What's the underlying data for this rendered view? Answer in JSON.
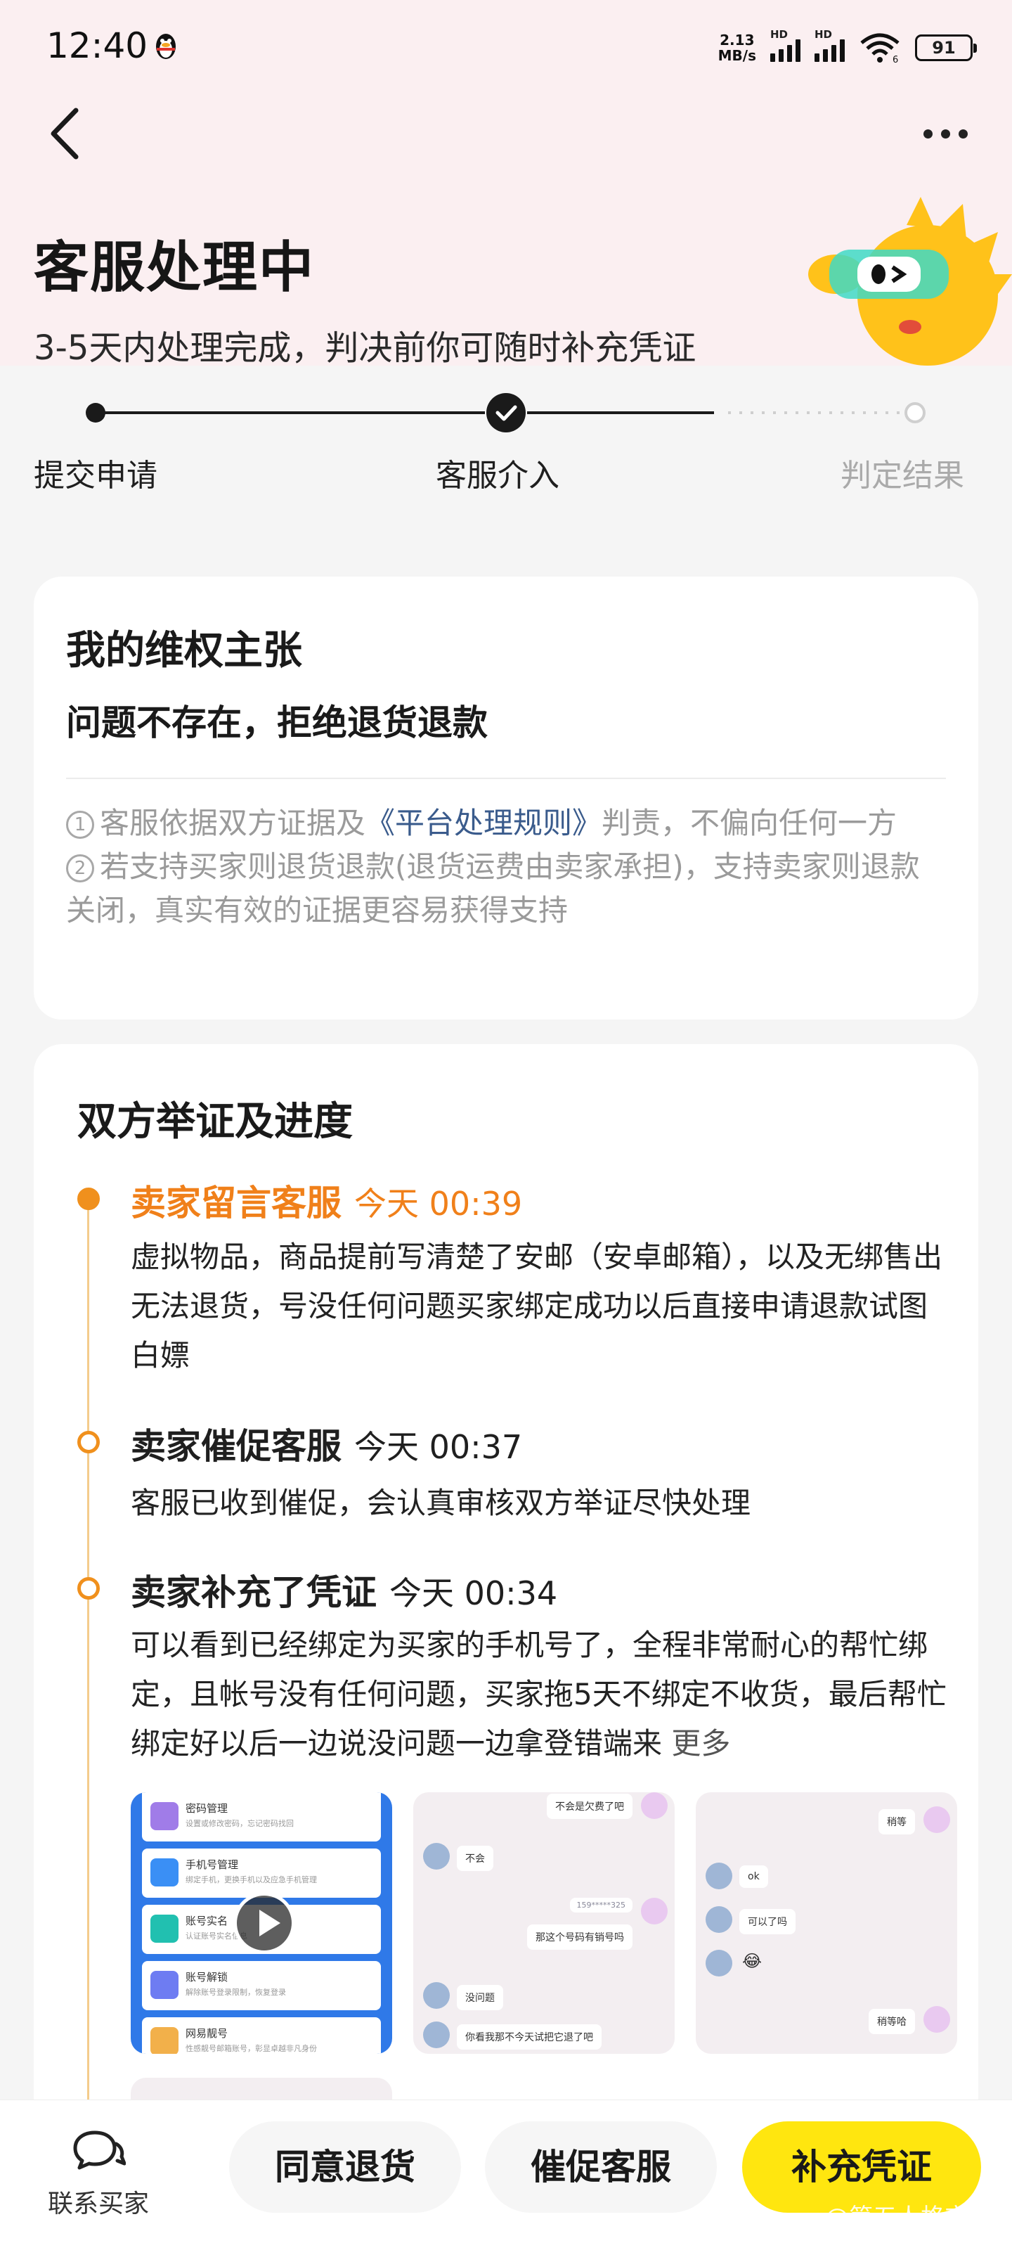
{
  "status_bar": {
    "time": "12:40",
    "net_speed_value": "2.13",
    "net_speed_unit": "MB/s",
    "hd1": "HD",
    "hd2": "HD",
    "wifi_sub": "6",
    "battery": "91",
    "icons": [
      "qq-penguin-icon",
      "signal-icon",
      "wifi-icon",
      "battery-icon"
    ]
  },
  "header": {
    "title": "客服处理中",
    "subtitle": "3-5天内处理完成，判决前你可随时补充凭证"
  },
  "progress": {
    "steps": [
      {
        "label": "提交申请",
        "state": "done"
      },
      {
        "label": "客服介入",
        "state": "current"
      },
      {
        "label": "判定结果",
        "state": "pending"
      }
    ]
  },
  "claim": {
    "heading": "我的维权主张",
    "value": "问题不存在，拒绝退货退款",
    "note1_num": "1",
    "note1_pre": "客服依据双方证据及",
    "note1_link": "《平台处理规则》",
    "note1_post": "判责，不偏向任何一方",
    "note2_num": "2",
    "note2": "若支持买家则退货退款(退货运费由卖家承担)，支持卖家则退款关闭，真实有效的证据更容易获得支持"
  },
  "evidence": {
    "heading": "双方举证及进度",
    "items": [
      {
        "title": "卖家留言客服",
        "time": "今天 00:39",
        "body": "虚拟物品，商品提前写清楚了安邮（安卓邮箱），以及无绑售出无法退货，号没任何问题买家绑定成功以后直接申请退款试图白嫖"
      },
      {
        "title": "卖家催促客服",
        "time": "今天 00:37",
        "body": "客服已收到催促，会认真审核双方举证尽快处理"
      },
      {
        "title": "卖家补充了凭证",
        "time": "今天 00:34",
        "body": "可以看到已经绑定为买家的手机号了，全程非常耐心的帮忙绑定，且帐号没有任何问题，买家拖5天不绑定不收货，最后帮忙绑定好以后一边说没问题一边拿登错端来",
        "more": "更多"
      }
    ],
    "thumb1": {
      "rows": [
        {
          "t1": "密码管理",
          "t2": "设置或修改密码，忘记密码找回"
        },
        {
          "t1": "手机号管理",
          "t2": "绑定手机，更换手机以及应急手机管理"
        },
        {
          "t1": "账号实名",
          "t2": "认证账号实名信息"
        },
        {
          "t1": "账号解锁",
          "t2": "解除账号登录限制，恢复登录"
        },
        {
          "t1": "网易靓号",
          "t2": "性感靓号邮箱账号，彰显卓越非凡身份"
        }
      ]
    },
    "thumb2": {
      "msgs": [
        "不会是欠费了吧",
        "不会",
        "159*****325",
        "那这个号码有销号吗",
        "没问题",
        "你看我那不今天试把它退了吧"
      ]
    },
    "thumb3": {
      "msgs": [
        "稍等",
        "ok",
        "可以了吗",
        "😂",
        "稍等哈"
      ]
    }
  },
  "bottom_bar": {
    "contact_label": "联系买家",
    "agree_label": "同意退货",
    "urge_label": "催促客服",
    "supplement_label": "补充凭证",
    "watermark": "@第五人格交易"
  },
  "colors": {
    "accent_orange": "#f0801a",
    "button_yellow": "#ffe60f",
    "link_blue": "#3a5b8c"
  }
}
